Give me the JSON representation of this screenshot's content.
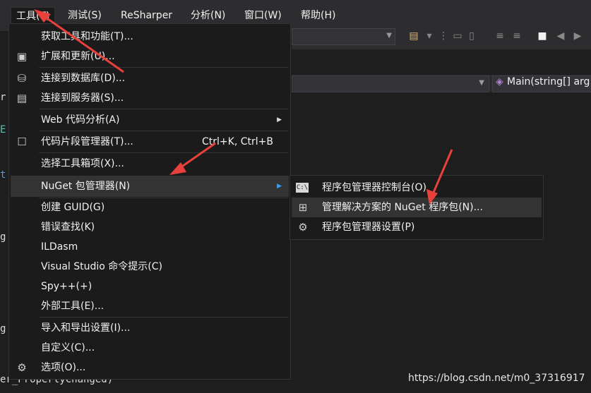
{
  "menubar": {
    "items": [
      "工具(T)",
      "测试(S)",
      "ReSharper",
      "分析(N)",
      "窗口(W)",
      "帮助(H)"
    ]
  },
  "nav": {
    "method_label": "Main(string[] arg"
  },
  "code_fragments": [
    "r",
    "E",
    "t",
    "g",
    "g",
    "er_PropertyChanged)"
  ],
  "tools_menu": {
    "items": [
      {
        "icon": "",
        "label": "获取工具和功能(T)..."
      },
      {
        "icon": "extensions-icon",
        "label": "扩展和更新(U)..."
      },
      {
        "icon": "database-connect-icon",
        "label": "连接到数据库(D)..."
      },
      {
        "icon": "server-connect-icon",
        "label": "连接到服务器(S)..."
      },
      {
        "icon": "",
        "label": "Web 代码分析(A)"
      },
      {
        "icon": "snippet-manager-icon",
        "label": "代码片段管理器(T)...",
        "shortcut": "Ctrl+K, Ctrl+B"
      },
      {
        "icon": "",
        "label": "选择工具箱项(X)..."
      },
      {
        "icon": "",
        "label": "NuGet 包管理器(N)"
      },
      {
        "icon": "",
        "label": "创建 GUID(G)"
      },
      {
        "icon": "",
        "label": "错误查找(K)"
      },
      {
        "icon": "",
        "label": "ILDasm"
      },
      {
        "icon": "",
        "label": "Visual Studio 命令提示(C)"
      },
      {
        "icon": "",
        "label": "Spy++(+)"
      },
      {
        "icon": "",
        "label": "外部工具(E)..."
      },
      {
        "icon": "",
        "label": "导入和导出设置(I)..."
      },
      {
        "icon": "",
        "label": "自定义(C)..."
      },
      {
        "icon": "gear-icon",
        "label": "选项(O)..."
      }
    ]
  },
  "nuget_submenu": {
    "items": [
      {
        "icon": "console-icon",
        "label": "程序包管理器控制台(O)"
      },
      {
        "icon": "package-icon",
        "label": "管理解决方案的 NuGet 程序包(N)..."
      },
      {
        "icon": "gear-icon",
        "label": "程序包管理器设置(P)"
      }
    ]
  },
  "watermark": "https://blog.csdn.net/m0_37316917",
  "colors": {
    "menubar_bg": "#2d2d30",
    "menu_bg": "#1b1b1c",
    "highlight": "#333334",
    "annotation_arrow": "#e8403a"
  }
}
